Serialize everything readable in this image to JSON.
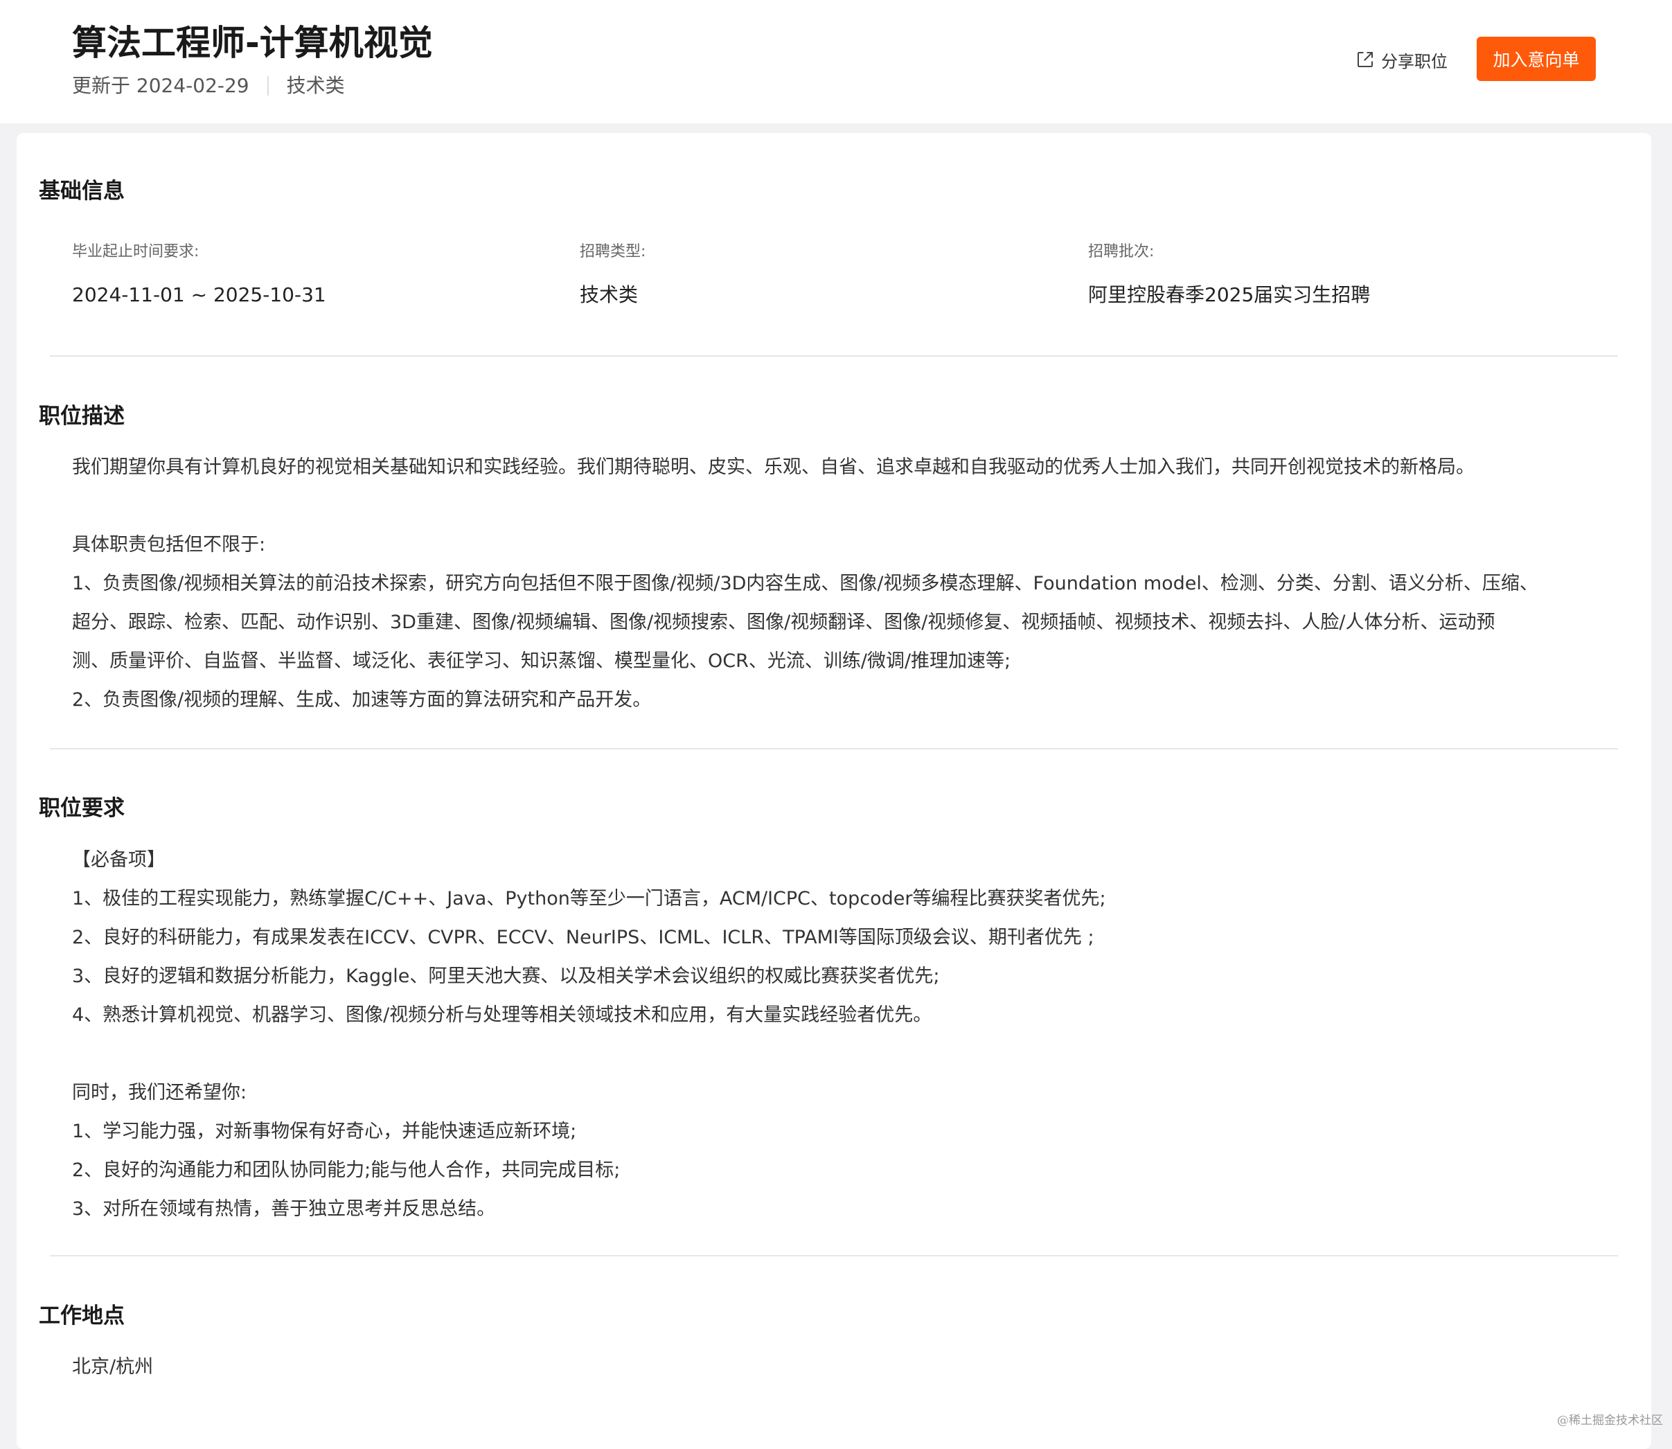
{
  "header": {
    "title": "算法工程师-计算机视觉",
    "updated": "更新于 2024-02-29",
    "category": "技术类",
    "share_label": "分享职位",
    "share_icon": "external-share-icon",
    "apply_label": "加入意向单",
    "accent_color": "#ff5a0a"
  },
  "basic_info": {
    "title": "基础信息",
    "fields": [
      {
        "label": "毕业起止时间要求:",
        "value": "2024-11-01 ~ 2025-10-31"
      },
      {
        "label": "招聘类型:",
        "value": "技术类"
      },
      {
        "label": "招聘批次:",
        "value": "阿里控股春季2025届实习生招聘"
      }
    ]
  },
  "description": {
    "title": "职位描述",
    "lines": [
      "我们期望你具有计算机良好的视觉相关基础知识和实践经验。我们期待聪明、皮实、乐观、自省、追求卓越和自我驱动的优秀人士加入我们，共同开创视觉技术的新格局。",
      "",
      "具体职责包括但不限于:",
      "1、负责图像/视频相关算法的前沿技术探索，研究方向包括但不限于图像/视频/3D内容生成、图像/视频多模态理解、Foundation model、检测、分类、分割、语义分析、压缩、",
      "超分、跟踪、检索、匹配、动作识别、3D重建、图像/视频编辑、图像/视频搜索、图像/视频翻译、图像/视频修复、视频插帧、视频技术、视频去抖、人脸/人体分析、运动预",
      "测、质量评价、自监督、半监督、域泛化、表征学习、知识蒸馏、模型量化、OCR、光流、训练/微调/推理加速等;",
      "2、负责图像/视频的理解、生成、加速等方面的算法研究和产品开发。"
    ]
  },
  "requirements": {
    "title": "职位要求",
    "lines": [
      "【必备项】",
      "1、极佳的工程实现能力，熟练掌握C/C++、Java、Python等至少一门语言，ACM/ICPC、topcoder等编程比赛获奖者优先;",
      "2、良好的科研能力，有成果发表在ICCV、CVPR、ECCV、NeurIPS、ICML、ICLR、TPAMI等国际顶级会议、期刊者优先 ;",
      "3、良好的逻辑和数据分析能力，Kaggle、阿里天池大赛、以及相关学术会议组织的权威比赛获奖者优先;",
      "4、熟悉计算机视觉、机器学习、图像/视频分析与处理等相关领域技术和应用，有大量实践经验者优先。",
      "",
      "同时，我们还希望你:",
      "1、学习能力强，对新事物保有好奇心，并能快速适应新环境;",
      "2、良好的沟通能力和团队协同能力;能与他人合作，共同完成目标;",
      "3、对所在领域有热情，善于独立思考并反思总结。"
    ]
  },
  "location": {
    "title": "工作地点",
    "value": "北京/杭州"
  },
  "watermark": "@稀土掘金技术社区"
}
